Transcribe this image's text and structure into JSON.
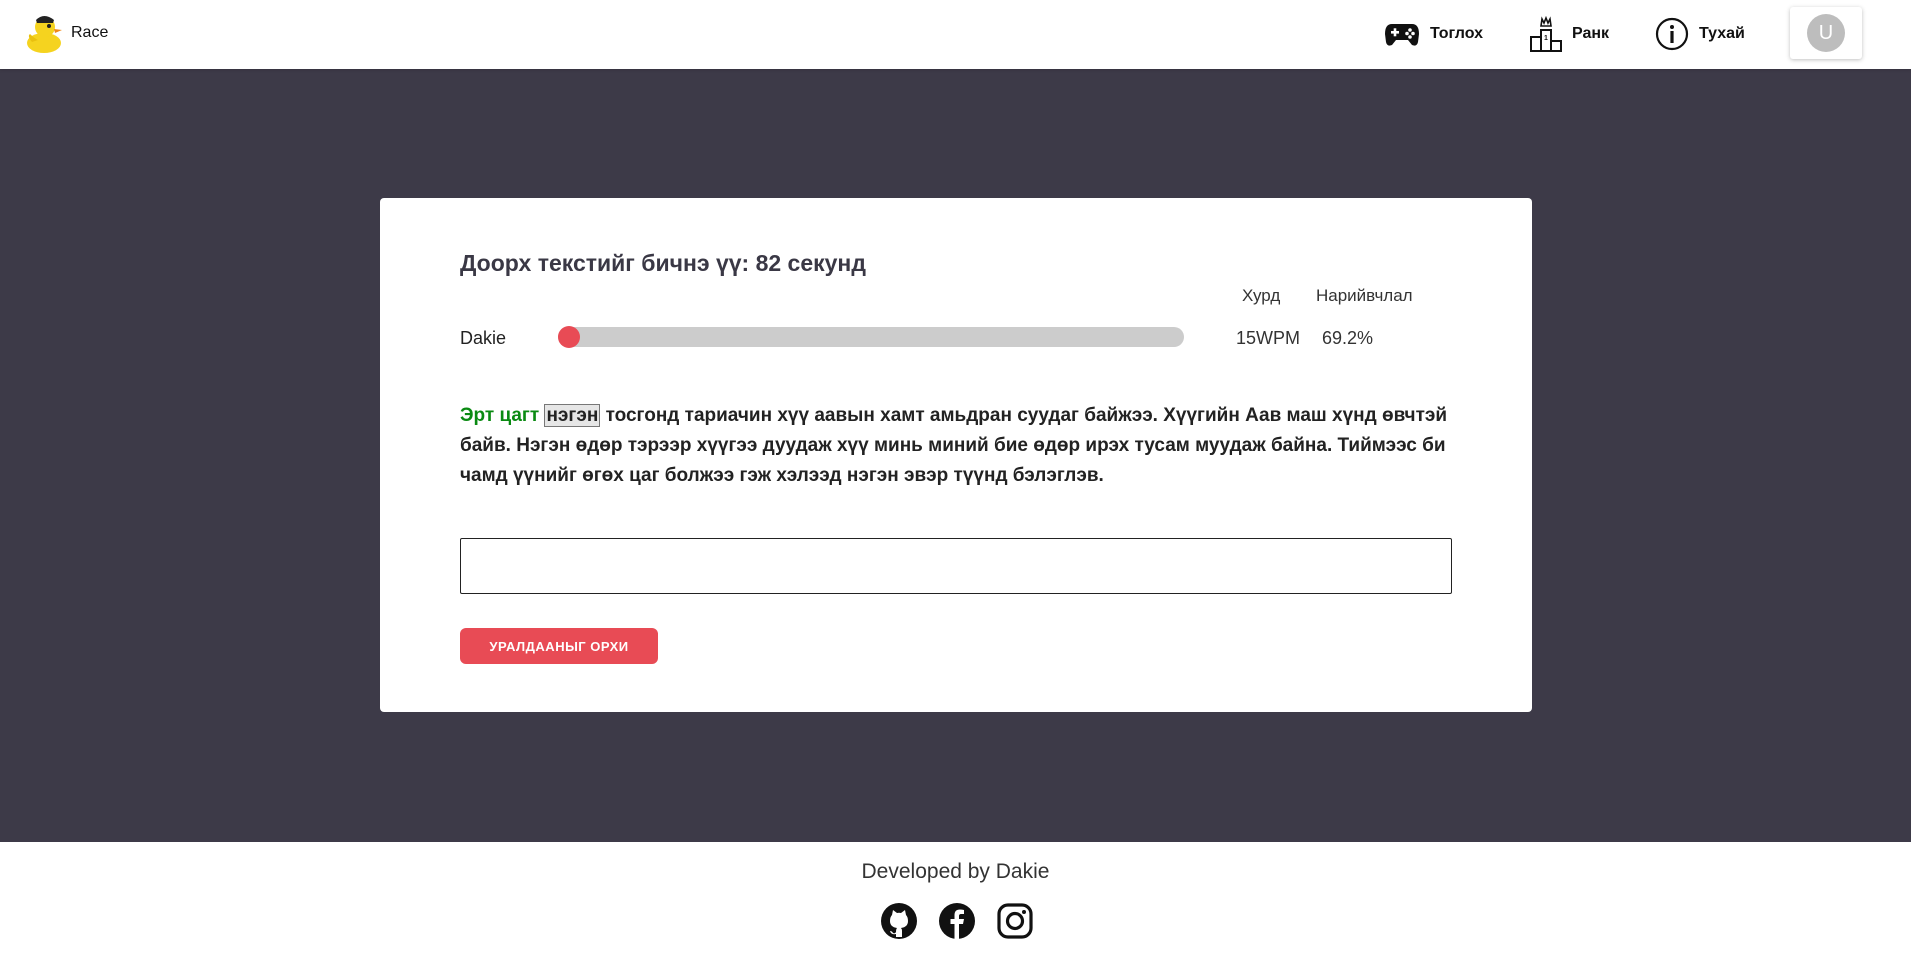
{
  "header": {
    "brand_name": "Race",
    "nav": [
      {
        "label": "Тоглох",
        "icon": "gamepad-icon"
      },
      {
        "label": "Ранк",
        "icon": "podium-icon"
      },
      {
        "label": "Тухай",
        "icon": "info-icon"
      }
    ],
    "avatar_initial": "U"
  },
  "race": {
    "prompt": "Доорх текстийг бичнэ үү: 82 секунд",
    "speed_header": "Хурд",
    "accuracy_header": "Нарийвчлал",
    "player": {
      "name": "Dakie",
      "progress": 0.0,
      "speed": "15WPM",
      "accuracy": "69.2%"
    },
    "passage": {
      "typed": "Эрт цагт",
      "current": "нэгэн",
      "remaining": "тосгонд тариачин хүү аавын хамт амьдран суудаг байжээ. Хүүгийн Аав маш хүнд өвчтэй байв. Нэгэн өдөр тэрээр хүүгээ дуудаж хүү минь миний бие өдөр ирэх тусам муудаж байна. Тиймээс би чамд үүнийг өгөх цаг болжээ гэж хэлээд нэгэн эвэр түүнд бэлэглэв."
    },
    "input_value": "",
    "leave_button": "УРАЛДААНЫГ ОРХИ"
  },
  "colors": {
    "accent": "#e84b55",
    "typed": "#0a8a12",
    "background": "#3d3a48"
  },
  "footer": {
    "credit": "Developed by Dakie",
    "socials": [
      "github-icon",
      "facebook-icon",
      "instagram-icon"
    ]
  }
}
